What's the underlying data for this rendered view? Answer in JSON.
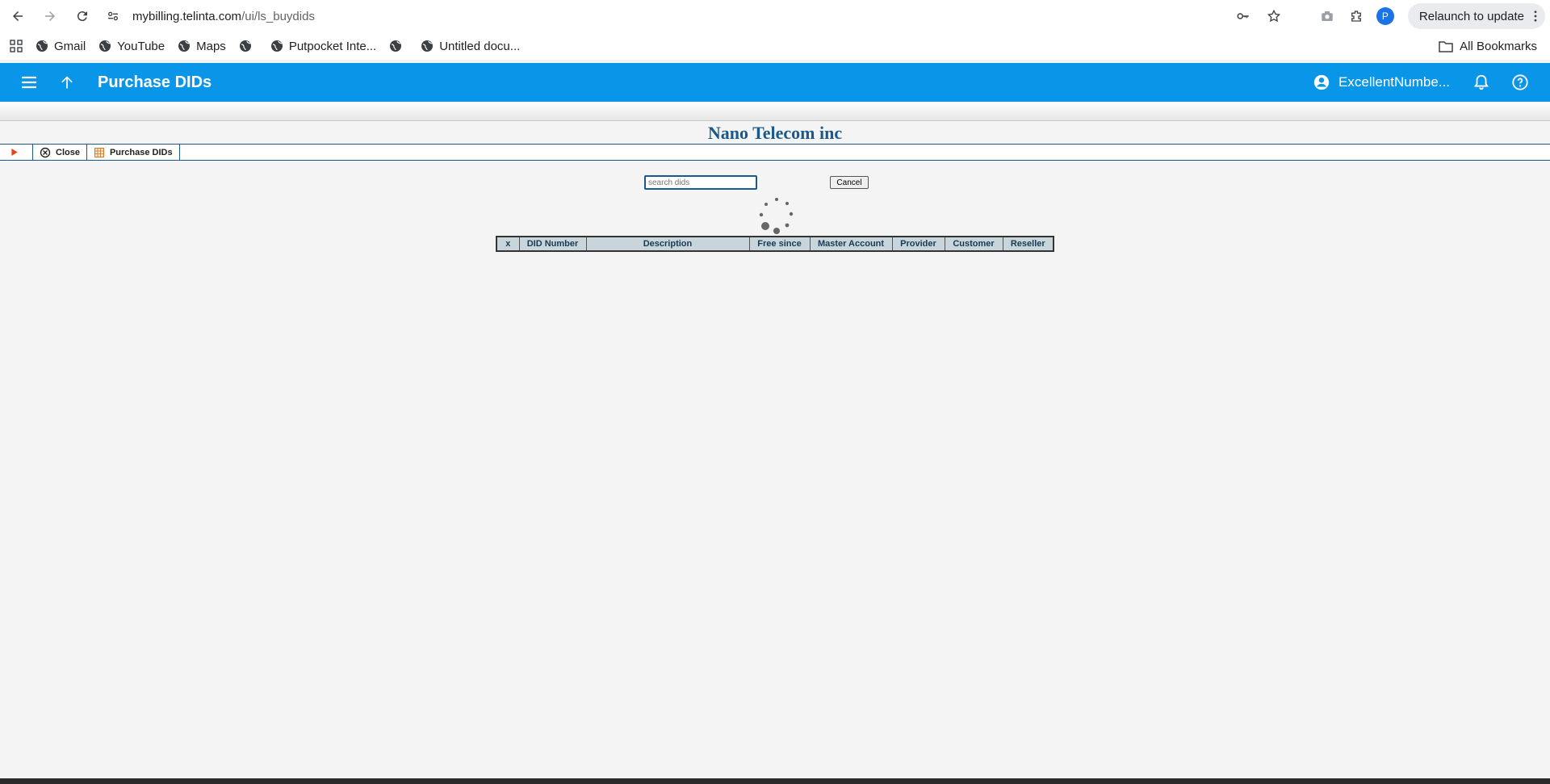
{
  "browser": {
    "url_host": "mybilling.telinta.com",
    "url_path": "/ui/ls_buydids",
    "relaunch_label": "Relaunch to update",
    "profile_initial": "P"
  },
  "bookmarks": {
    "items": [
      {
        "label": "Gmail"
      },
      {
        "label": "YouTube"
      },
      {
        "label": "Maps"
      },
      {
        "label": ""
      },
      {
        "label": "Putpocket Inte..."
      },
      {
        "label": ""
      },
      {
        "label": "Untitled docu..."
      }
    ],
    "all_label": "All Bookmarks"
  },
  "header": {
    "title": "Purchase DIDs",
    "user": "ExcellentNumbe..."
  },
  "company": "Nano Telecom inc",
  "toolbar": {
    "close_label": "Close",
    "purchase_label": "Purchase DIDs"
  },
  "search": {
    "placeholder": "search dids",
    "value": "",
    "cancel_label": "Cancel"
  },
  "table": {
    "columns": [
      "x",
      "DID Number",
      "Description",
      "Free since",
      "Master Account",
      "Provider",
      "Customer",
      "Reseller"
    ]
  },
  "colors": {
    "header_bg": "#0a96e8",
    "company_text": "#1a5a8a",
    "table_header_bg": "#c8d6dc"
  }
}
